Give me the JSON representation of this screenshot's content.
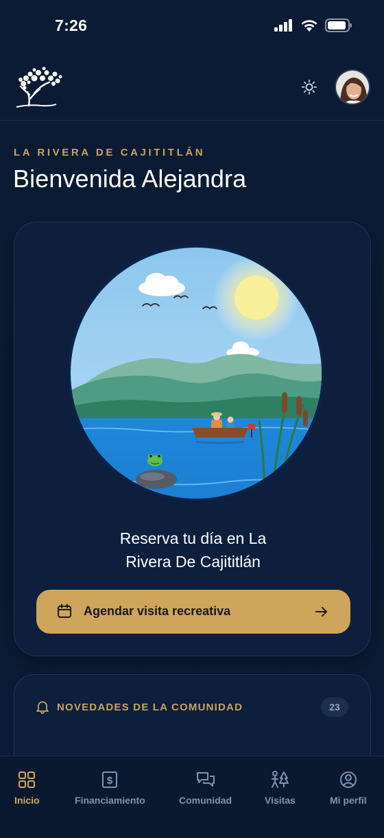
{
  "status_bar": {
    "time": "7:26"
  },
  "header": {
    "logo": "tree-logo-icon",
    "theme_toggle": "sun-icon",
    "avatar": "user-avatar"
  },
  "greeting": {
    "eyebrow": "LA RIVERA DE CAJITITLÁN",
    "title": "Bienvenida Alejandra"
  },
  "hero": {
    "illustration": "lake-landscape",
    "line1": "Reserva tu día en La",
    "line2": "Rivera De Cajititlán",
    "cta_icon": "calendar-icon",
    "cta_label": "Agendar visita recreativa",
    "cta_arrow": "arrow-right-icon"
  },
  "news": {
    "icon": "bell-icon",
    "title": "NOVEDADES DE LA COMUNIDAD",
    "count": "23"
  },
  "tabs": [
    {
      "label": "Inicio",
      "icon": "grid-icon",
      "active": true
    },
    {
      "label": "Financiamiento",
      "icon": "dollar-icon",
      "active": false
    },
    {
      "label": "Comunidad",
      "icon": "chat-icon",
      "active": false
    },
    {
      "label": "Visitas",
      "icon": "person-tree-icon",
      "active": false
    },
    {
      "label": "Mi perfil",
      "icon": "user-circle-icon",
      "active": false
    }
  ],
  "colors": {
    "background": "#0a1a33",
    "card": "#0d1f3d",
    "accent": "#cfa45b",
    "muted": "#7f93b1"
  }
}
